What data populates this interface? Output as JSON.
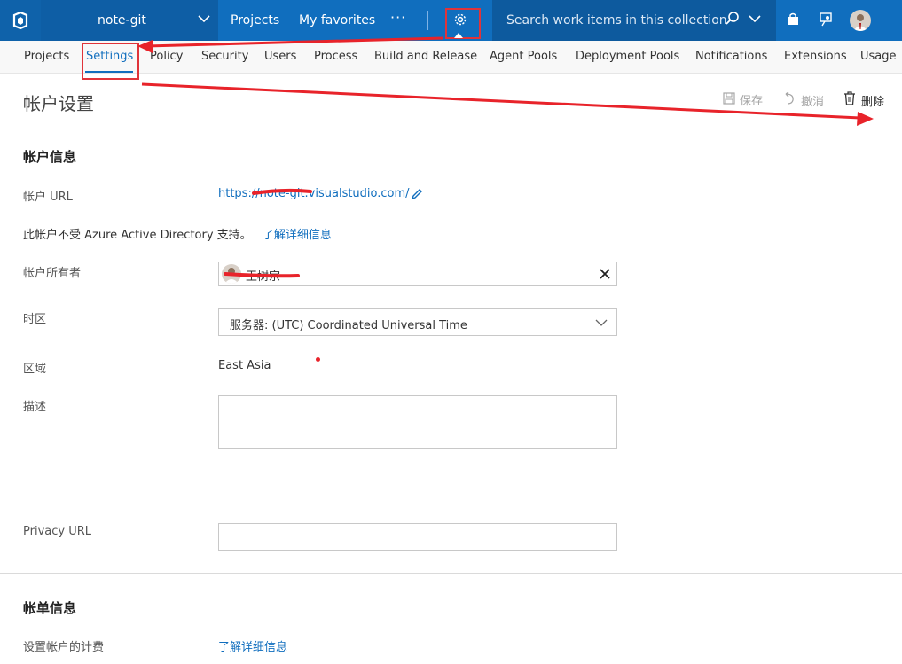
{
  "topbar": {
    "account_name": "note-git",
    "nav_projects": "Projects",
    "nav_favorites": "My favorites",
    "more": "···",
    "search_placeholder": "Search work items in this collection"
  },
  "hubs": [
    {
      "label": "Projects",
      "active": false
    },
    {
      "label": "Settings",
      "active": true
    },
    {
      "label": "Policy",
      "active": false
    },
    {
      "label": "Security",
      "active": false
    },
    {
      "label": "Users",
      "active": false
    },
    {
      "label": "Process",
      "active": false
    },
    {
      "label": "Build and Release",
      "active": false
    },
    {
      "label": "Agent Pools",
      "active": false
    },
    {
      "label": "Deployment Pools",
      "active": false
    },
    {
      "label": "Notifications",
      "active": false
    },
    {
      "label": "Extensions",
      "active": false
    },
    {
      "label": "Usage",
      "active": false
    }
  ],
  "page": {
    "title": "帐户设置",
    "save": "保存",
    "undo": "撤消",
    "delete": "删除"
  },
  "account_info": {
    "heading": "帐户信息",
    "url_label": "帐户 URL",
    "url_value": "https://note-git.visualstudio.com/",
    "aad_notice": "此帐户不受 Azure Active Directory 支持。",
    "learn_more": "了解详细信息",
    "owner_label": "帐户所有者",
    "owner_value": "王树宗",
    "timezone_label": "时区",
    "timezone_value": "服务器: (UTC) Coordinated Universal Time",
    "region_label": "区域",
    "region_value": "East Asia",
    "description_label": "描述",
    "description_value": "",
    "privacy_label": "Privacy URL",
    "privacy_value": ""
  },
  "billing": {
    "heading": "帐单信息",
    "setup_label": "设置帐户的计费",
    "learn_more": "了解详细信息"
  },
  "colors": {
    "topbar": "#106ebe",
    "accent": "#106ebe",
    "annotation": "#e8232a"
  }
}
